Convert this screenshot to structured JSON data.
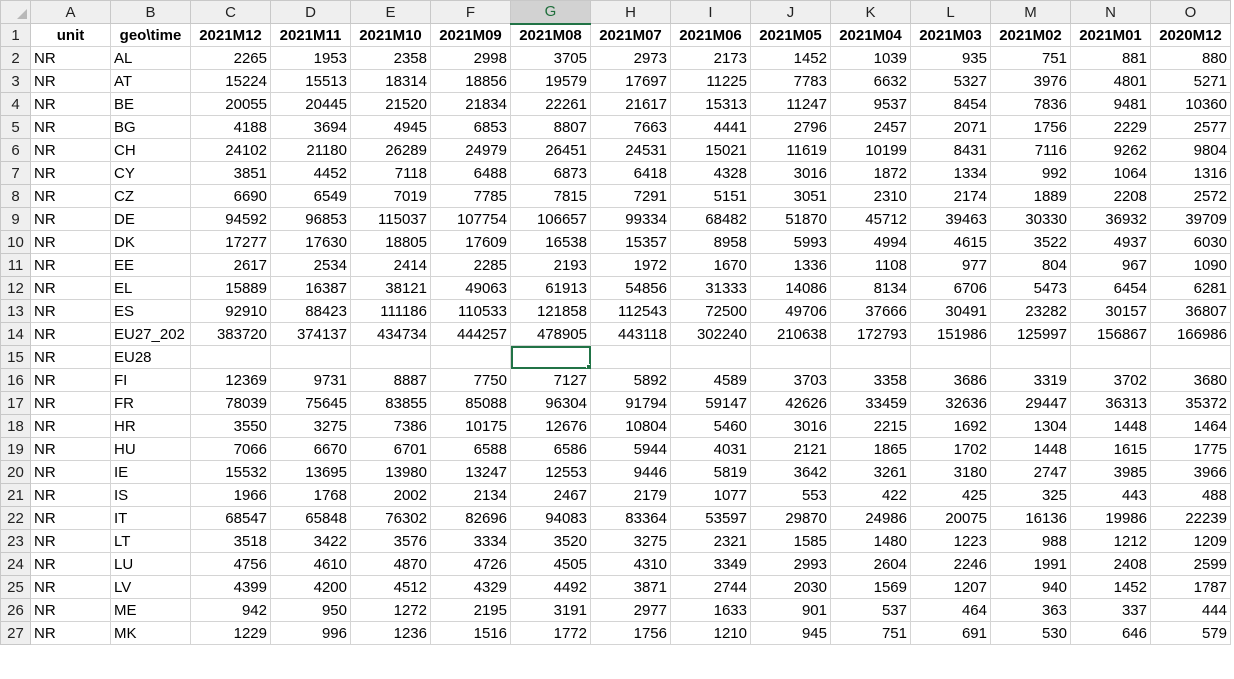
{
  "columns": [
    "A",
    "B",
    "C",
    "D",
    "E",
    "F",
    "G",
    "H",
    "I",
    "J",
    "K",
    "L",
    "M",
    "N",
    "O"
  ],
  "selected_column": "G",
  "active_cell": {
    "row": 15,
    "col": "G"
  },
  "rows": [
    {
      "n": "1",
      "cells": [
        "unit",
        "geo\\time",
        "2021M12",
        "2021M11",
        "2021M10",
        "2021M09",
        "2021M08",
        "2021M07",
        "2021M06",
        "2021M05",
        "2021M04",
        "2021M03",
        "2021M02",
        "2021M01",
        "2020M12"
      ]
    },
    {
      "n": "2",
      "cells": [
        "NR",
        "AL",
        "2265",
        "1953",
        "2358",
        "2998",
        "3705",
        "2973",
        "2173",
        "1452",
        "1039",
        "935",
        "751",
        "881",
        "880"
      ]
    },
    {
      "n": "3",
      "cells": [
        "NR",
        "AT",
        "15224",
        "15513",
        "18314",
        "18856",
        "19579",
        "17697",
        "11225",
        "7783",
        "6632",
        "5327",
        "3976",
        "4801",
        "5271"
      ]
    },
    {
      "n": "4",
      "cells": [
        "NR",
        "BE",
        "20055",
        "20445",
        "21520",
        "21834",
        "22261",
        "21617",
        "15313",
        "11247",
        "9537",
        "8454",
        "7836",
        "9481",
        "10360"
      ]
    },
    {
      "n": "5",
      "cells": [
        "NR",
        "BG",
        "4188",
        "3694",
        "4945",
        "6853",
        "8807",
        "7663",
        "4441",
        "2796",
        "2457",
        "2071",
        "1756",
        "2229",
        "2577"
      ]
    },
    {
      "n": "6",
      "cells": [
        "NR",
        "CH",
        "24102",
        "21180",
        "26289",
        "24979",
        "26451",
        "24531",
        "15021",
        "11619",
        "10199",
        "8431",
        "7116",
        "9262",
        "9804"
      ]
    },
    {
      "n": "7",
      "cells": [
        "NR",
        "CY",
        "3851",
        "4452",
        "7118",
        "6488",
        "6873",
        "6418",
        "4328",
        "3016",
        "1872",
        "1334",
        "992",
        "1064",
        "1316"
      ]
    },
    {
      "n": "8",
      "cells": [
        "NR",
        "CZ",
        "6690",
        "6549",
        "7019",
        "7785",
        "7815",
        "7291",
        "5151",
        "3051",
        "2310",
        "2174",
        "1889",
        "2208",
        "2572"
      ]
    },
    {
      "n": "9",
      "cells": [
        "NR",
        "DE",
        "94592",
        "96853",
        "115037",
        "107754",
        "106657",
        "99334",
        "68482",
        "51870",
        "45712",
        "39463",
        "30330",
        "36932",
        "39709"
      ]
    },
    {
      "n": "10",
      "cells": [
        "NR",
        "DK",
        "17277",
        "17630",
        "18805",
        "17609",
        "16538",
        "15357",
        "8958",
        "5993",
        "4994",
        "4615",
        "3522",
        "4937",
        "6030"
      ]
    },
    {
      "n": "11",
      "cells": [
        "NR",
        "EE",
        "2617",
        "2534",
        "2414",
        "2285",
        "2193",
        "1972",
        "1670",
        "1336",
        "1108",
        "977",
        "804",
        "967",
        "1090"
      ]
    },
    {
      "n": "12",
      "cells": [
        "NR",
        "EL",
        "15889",
        "16387",
        "38121",
        "49063",
        "61913",
        "54856",
        "31333",
        "14086",
        "8134",
        "6706",
        "5473",
        "6454",
        "6281"
      ]
    },
    {
      "n": "13",
      "cells": [
        "NR",
        "ES",
        "92910",
        "88423",
        "111186",
        "110533",
        "121858",
        "112543",
        "72500",
        "49706",
        "37666",
        "30491",
        "23282",
        "30157",
        "36807"
      ]
    },
    {
      "n": "14",
      "cells": [
        "NR",
        "EU27_202",
        "383720",
        "374137",
        "434734",
        "444257",
        "478905",
        "443118",
        "302240",
        "210638",
        "172793",
        "151986",
        "125997",
        "156867",
        "166986"
      ]
    },
    {
      "n": "15",
      "cells": [
        "NR",
        "EU28",
        "",
        "",
        "",
        "",
        "",
        "",
        "",
        "",
        "",
        "",
        "",
        "",
        ""
      ]
    },
    {
      "n": "16",
      "cells": [
        "NR",
        "FI",
        "12369",
        "9731",
        "8887",
        "7750",
        "7127",
        "5892",
        "4589",
        "3703",
        "3358",
        "3686",
        "3319",
        "3702",
        "3680"
      ]
    },
    {
      "n": "17",
      "cells": [
        "NR",
        "FR",
        "78039",
        "75645",
        "83855",
        "85088",
        "96304",
        "91794",
        "59147",
        "42626",
        "33459",
        "32636",
        "29447",
        "36313",
        "35372"
      ]
    },
    {
      "n": "18",
      "cells": [
        "NR",
        "HR",
        "3550",
        "3275",
        "7386",
        "10175",
        "12676",
        "10804",
        "5460",
        "3016",
        "2215",
        "1692",
        "1304",
        "1448",
        "1464"
      ]
    },
    {
      "n": "19",
      "cells": [
        "NR",
        "HU",
        "7066",
        "6670",
        "6701",
        "6588",
        "6586",
        "5944",
        "4031",
        "2121",
        "1865",
        "1702",
        "1448",
        "1615",
        "1775"
      ]
    },
    {
      "n": "20",
      "cells": [
        "NR",
        "IE",
        "15532",
        "13695",
        "13980",
        "13247",
        "12553",
        "9446",
        "5819",
        "3642",
        "3261",
        "3180",
        "2747",
        "3985",
        "3966"
      ]
    },
    {
      "n": "21",
      "cells": [
        "NR",
        "IS",
        "1966",
        "1768",
        "2002",
        "2134",
        "2467",
        "2179",
        "1077",
        "553",
        "422",
        "425",
        "325",
        "443",
        "488"
      ]
    },
    {
      "n": "22",
      "cells": [
        "NR",
        "IT",
        "68547",
        "65848",
        "76302",
        "82696",
        "94083",
        "83364",
        "53597",
        "29870",
        "24986",
        "20075",
        "16136",
        "19986",
        "22239"
      ]
    },
    {
      "n": "23",
      "cells": [
        "NR",
        "LT",
        "3518",
        "3422",
        "3576",
        "3334",
        "3520",
        "3275",
        "2321",
        "1585",
        "1480",
        "1223",
        "988",
        "1212",
        "1209"
      ]
    },
    {
      "n": "24",
      "cells": [
        "NR",
        "LU",
        "4756",
        "4610",
        "4870",
        "4726",
        "4505",
        "4310",
        "3349",
        "2993",
        "2604",
        "2246",
        "1991",
        "2408",
        "2599"
      ]
    },
    {
      "n": "25",
      "cells": [
        "NR",
        "LV",
        "4399",
        "4200",
        "4512",
        "4329",
        "4492",
        "3871",
        "2744",
        "2030",
        "1569",
        "1207",
        "940",
        "1452",
        "1787"
      ]
    },
    {
      "n": "26",
      "cells": [
        "NR",
        "ME",
        "942",
        "950",
        "1272",
        "2195",
        "3191",
        "2977",
        "1633",
        "901",
        "537",
        "464",
        "363",
        "337",
        "444"
      ]
    },
    {
      "n": "27",
      "cells": [
        "NR",
        "MK",
        "1229",
        "996",
        "1236",
        "1516",
        "1772",
        "1756",
        "1210",
        "945",
        "751",
        "691",
        "530",
        "646",
        "579"
      ]
    }
  ]
}
